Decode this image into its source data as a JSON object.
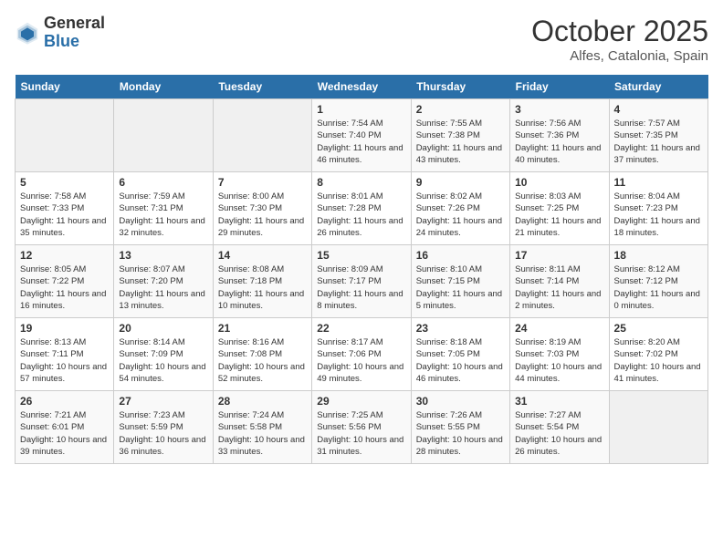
{
  "header": {
    "logo_general": "General",
    "logo_blue": "Blue",
    "title": "October 2025",
    "subtitle": "Alfes, Catalonia, Spain"
  },
  "weekdays": [
    "Sunday",
    "Monday",
    "Tuesday",
    "Wednesday",
    "Thursday",
    "Friday",
    "Saturday"
  ],
  "weeks": [
    [
      {
        "day": "",
        "info": ""
      },
      {
        "day": "",
        "info": ""
      },
      {
        "day": "",
        "info": ""
      },
      {
        "day": "1",
        "info": "Sunrise: 7:54 AM\nSunset: 7:40 PM\nDaylight: 11 hours and 46 minutes."
      },
      {
        "day": "2",
        "info": "Sunrise: 7:55 AM\nSunset: 7:38 PM\nDaylight: 11 hours and 43 minutes."
      },
      {
        "day": "3",
        "info": "Sunrise: 7:56 AM\nSunset: 7:36 PM\nDaylight: 11 hours and 40 minutes."
      },
      {
        "day": "4",
        "info": "Sunrise: 7:57 AM\nSunset: 7:35 PM\nDaylight: 11 hours and 37 minutes."
      }
    ],
    [
      {
        "day": "5",
        "info": "Sunrise: 7:58 AM\nSunset: 7:33 PM\nDaylight: 11 hours and 35 minutes."
      },
      {
        "day": "6",
        "info": "Sunrise: 7:59 AM\nSunset: 7:31 PM\nDaylight: 11 hours and 32 minutes."
      },
      {
        "day": "7",
        "info": "Sunrise: 8:00 AM\nSunset: 7:30 PM\nDaylight: 11 hours and 29 minutes."
      },
      {
        "day": "8",
        "info": "Sunrise: 8:01 AM\nSunset: 7:28 PM\nDaylight: 11 hours and 26 minutes."
      },
      {
        "day": "9",
        "info": "Sunrise: 8:02 AM\nSunset: 7:26 PM\nDaylight: 11 hours and 24 minutes."
      },
      {
        "day": "10",
        "info": "Sunrise: 8:03 AM\nSunset: 7:25 PM\nDaylight: 11 hours and 21 minutes."
      },
      {
        "day": "11",
        "info": "Sunrise: 8:04 AM\nSunset: 7:23 PM\nDaylight: 11 hours and 18 minutes."
      }
    ],
    [
      {
        "day": "12",
        "info": "Sunrise: 8:05 AM\nSunset: 7:22 PM\nDaylight: 11 hours and 16 minutes."
      },
      {
        "day": "13",
        "info": "Sunrise: 8:07 AM\nSunset: 7:20 PM\nDaylight: 11 hours and 13 minutes."
      },
      {
        "day": "14",
        "info": "Sunrise: 8:08 AM\nSunset: 7:18 PM\nDaylight: 11 hours and 10 minutes."
      },
      {
        "day": "15",
        "info": "Sunrise: 8:09 AM\nSunset: 7:17 PM\nDaylight: 11 hours and 8 minutes."
      },
      {
        "day": "16",
        "info": "Sunrise: 8:10 AM\nSunset: 7:15 PM\nDaylight: 11 hours and 5 minutes."
      },
      {
        "day": "17",
        "info": "Sunrise: 8:11 AM\nSunset: 7:14 PM\nDaylight: 11 hours and 2 minutes."
      },
      {
        "day": "18",
        "info": "Sunrise: 8:12 AM\nSunset: 7:12 PM\nDaylight: 11 hours and 0 minutes."
      }
    ],
    [
      {
        "day": "19",
        "info": "Sunrise: 8:13 AM\nSunset: 7:11 PM\nDaylight: 10 hours and 57 minutes."
      },
      {
        "day": "20",
        "info": "Sunrise: 8:14 AM\nSunset: 7:09 PM\nDaylight: 10 hours and 54 minutes."
      },
      {
        "day": "21",
        "info": "Sunrise: 8:16 AM\nSunset: 7:08 PM\nDaylight: 10 hours and 52 minutes."
      },
      {
        "day": "22",
        "info": "Sunrise: 8:17 AM\nSunset: 7:06 PM\nDaylight: 10 hours and 49 minutes."
      },
      {
        "day": "23",
        "info": "Sunrise: 8:18 AM\nSunset: 7:05 PM\nDaylight: 10 hours and 46 minutes."
      },
      {
        "day": "24",
        "info": "Sunrise: 8:19 AM\nSunset: 7:03 PM\nDaylight: 10 hours and 44 minutes."
      },
      {
        "day": "25",
        "info": "Sunrise: 8:20 AM\nSunset: 7:02 PM\nDaylight: 10 hours and 41 minutes."
      }
    ],
    [
      {
        "day": "26",
        "info": "Sunrise: 7:21 AM\nSunset: 6:01 PM\nDaylight: 10 hours and 39 minutes."
      },
      {
        "day": "27",
        "info": "Sunrise: 7:23 AM\nSunset: 5:59 PM\nDaylight: 10 hours and 36 minutes."
      },
      {
        "day": "28",
        "info": "Sunrise: 7:24 AM\nSunset: 5:58 PM\nDaylight: 10 hours and 33 minutes."
      },
      {
        "day": "29",
        "info": "Sunrise: 7:25 AM\nSunset: 5:56 PM\nDaylight: 10 hours and 31 minutes."
      },
      {
        "day": "30",
        "info": "Sunrise: 7:26 AM\nSunset: 5:55 PM\nDaylight: 10 hours and 28 minutes."
      },
      {
        "day": "31",
        "info": "Sunrise: 7:27 AM\nSunset: 5:54 PM\nDaylight: 10 hours and 26 minutes."
      },
      {
        "day": "",
        "info": ""
      }
    ]
  ]
}
